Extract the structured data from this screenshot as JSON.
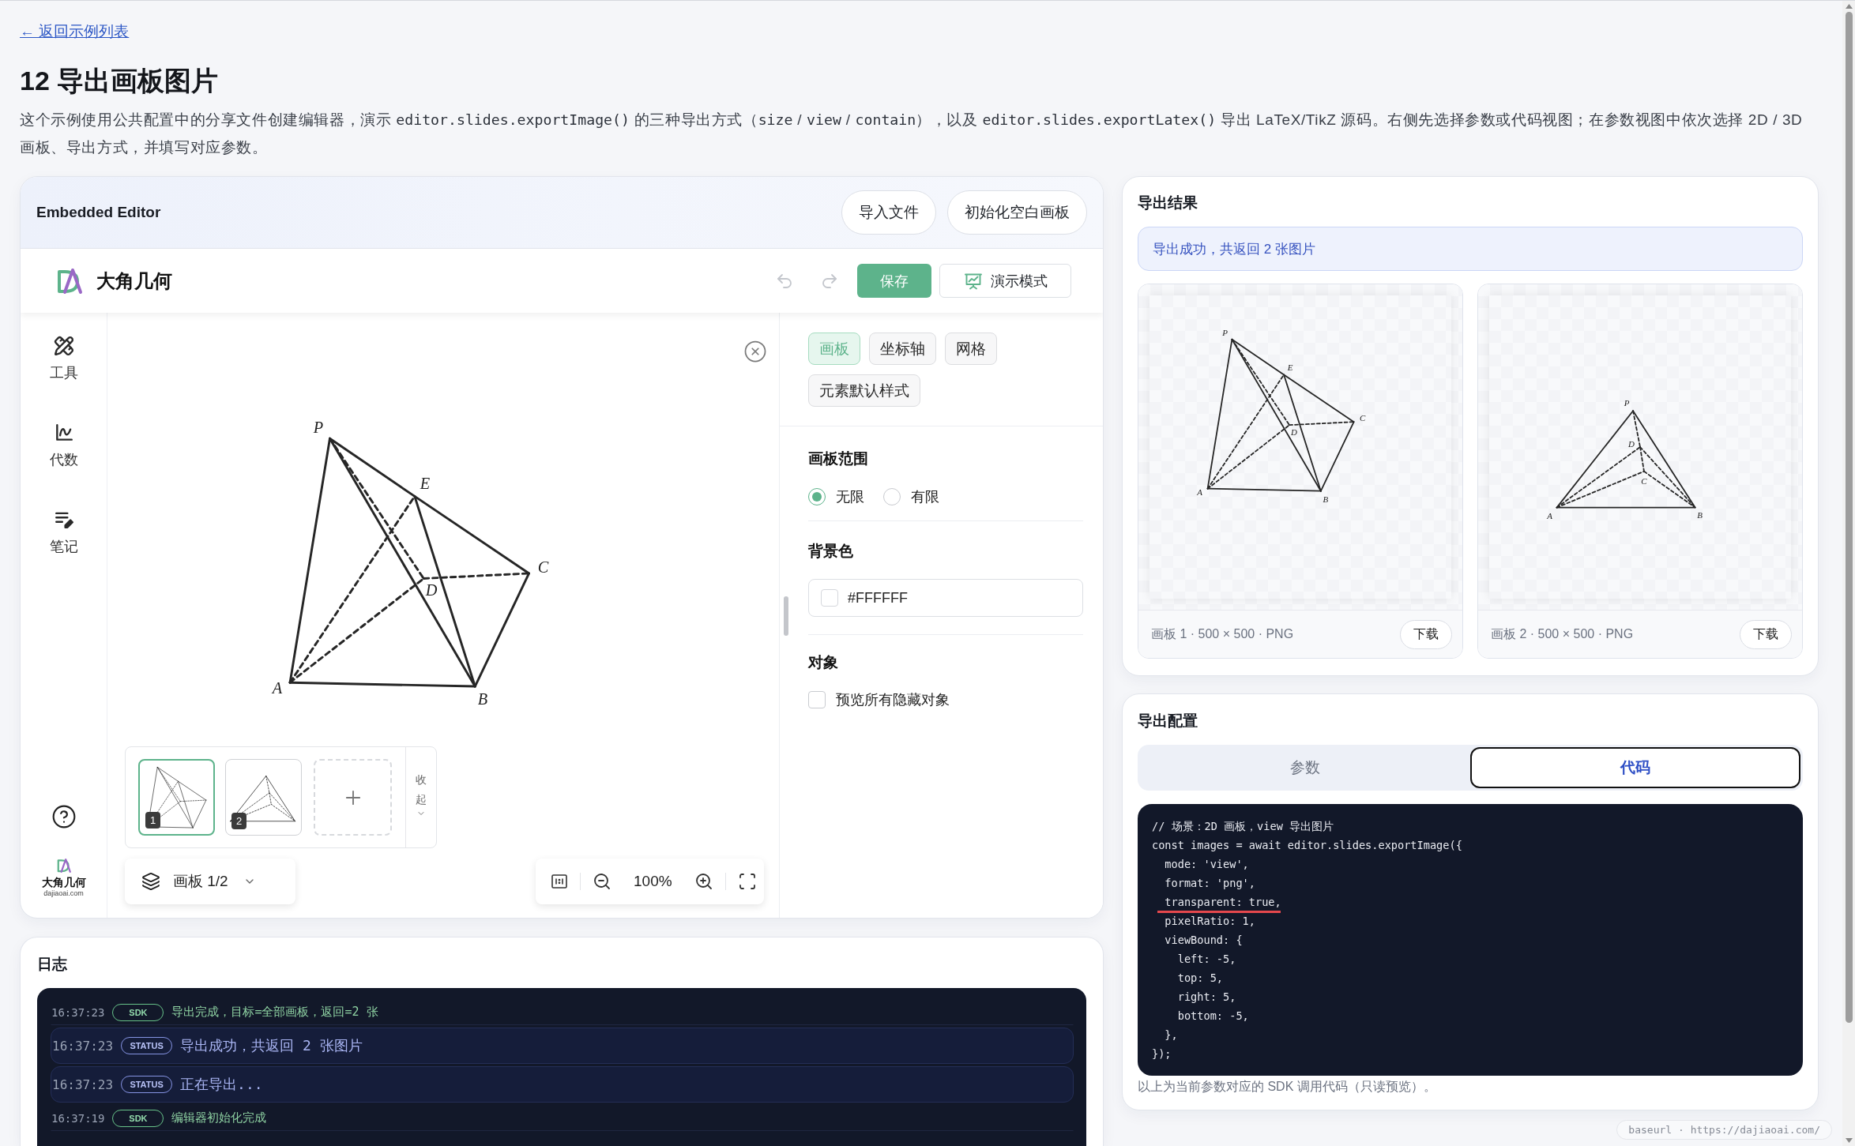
{
  "page": {
    "back_link": "← 返回示例列表",
    "title": "12 导出画板图片",
    "description": [
      {
        "kind": "text",
        "text": "这个示例使用公共配置中的分享文件创建编辑器，演示 "
      },
      {
        "kind": "code",
        "text": "editor.slides.exportImage()"
      },
      {
        "kind": "text",
        "text": " 的三种导出方式（"
      },
      {
        "kind": "code",
        "text": "size"
      },
      {
        "kind": "text",
        "text": " / "
      },
      {
        "kind": "code",
        "text": "view"
      },
      {
        "kind": "text",
        "text": " / "
      },
      {
        "kind": "code",
        "text": "contain"
      },
      {
        "kind": "text",
        "text": "），以及 "
      },
      {
        "kind": "code",
        "text": "editor.slides.exportLatex()"
      },
      {
        "kind": "text",
        "text": " 导出 LaTeX/TikZ 源码。右侧先选择参数或代码视图；在参数视图中依次选择 2D / 3D 画板、导出方式，并填写对应参数。"
      }
    ]
  },
  "editor": {
    "title": "Embedded Editor",
    "actions": [
      "导入文件",
      "初始化空白画板"
    ],
    "toolbar": {
      "brand": "大角几何",
      "history": [
        {
          "kind": "undo",
          "disabled": true
        },
        {
          "kind": "redo",
          "disabled": true
        }
      ],
      "save": "保存",
      "present": "演示模式"
    },
    "sidebar": {
      "items": [
        {
          "kind": "tools",
          "label": "工具"
        },
        {
          "kind": "algebra",
          "label": "代数"
        },
        {
          "kind": "notes",
          "label": "笔记"
        }
      ],
      "brand": "大角几何",
      "domain": "dajiaoai.com"
    },
    "canvas": {
      "figure": {
        "kind": "pyramid",
        "labels": [
          "P",
          "E",
          "C",
          "D",
          "A",
          "B"
        ]
      }
    },
    "slides": {
      "thumbnails": [
        {
          "number": "1",
          "kind": "pyramid",
          "selected": true
        },
        {
          "number": "2",
          "kind": "tetrahedron",
          "selected": false
        }
      ],
      "collapse": "收起",
      "current": "画板 1/2",
      "zoom": "100%"
    },
    "panel": {
      "tabs": [
        {
          "label": "画板",
          "selected": true
        },
        {
          "label": "坐标轴",
          "selected": false
        },
        {
          "label": "网格",
          "selected": false
        },
        {
          "label": "元素默认样式",
          "selected": false
        }
      ],
      "range": {
        "heading": "画板范围",
        "options": [
          {
            "label": "无限",
            "selected": true
          },
          {
            "label": "有限",
            "selected": false
          }
        ]
      },
      "background": {
        "heading": "背景色",
        "value": "#FFFFFF"
      },
      "objects": {
        "heading": "对象",
        "option": {
          "label": "预览所有隐藏对象",
          "checked": false
        }
      }
    }
  },
  "export_result": {
    "title": "导出结果",
    "alert": "导出成功，共返回 2 张图片",
    "images": [
      {
        "kind": "pyramid",
        "labels": [
          "P",
          "E",
          "C",
          "D",
          "A",
          "B"
        ],
        "meta": "画板 1 · 500 × 500 · PNG",
        "download": "下载"
      },
      {
        "kind": "tetrahedron",
        "labels": [
          "P",
          "D",
          "C",
          "A",
          "B"
        ],
        "meta": "画板 2 · 500 × 500 · PNG",
        "download": "下载"
      }
    ]
  },
  "export_config": {
    "title": "导出配置",
    "tabs": [
      {
        "label": "参数",
        "selected": false
      },
      {
        "label": "代码",
        "selected": true
      }
    ],
    "code": [
      {
        "text": "// 场景：2D 画板，view 导出图片",
        "highlighted": false
      },
      {
        "text": "const images = await editor.slides.exportImage({",
        "highlighted": false
      },
      {
        "text": "  mode: 'view',",
        "highlighted": false
      },
      {
        "text": "  format: 'png',",
        "highlighted": false
      },
      {
        "text": "  transparent: true,",
        "highlighted": true
      },
      {
        "text": "  pixelRatio: 1,",
        "highlighted": false
      },
      {
        "text": "  viewBound: {",
        "highlighted": false
      },
      {
        "text": "    left: -5,",
        "highlighted": false
      },
      {
        "text": "    top: 5,",
        "highlighted": false
      },
      {
        "text": "    right: 5,",
        "highlighted": false
      },
      {
        "text": "    bottom: -5,",
        "highlighted": false
      },
      {
        "text": "  },",
        "highlighted": false
      },
      {
        "text": "});",
        "highlighted": false
      }
    ],
    "note": "以上为当前参数对应的 SDK 调用代码（只读预览）。"
  },
  "log": {
    "title": "日志",
    "entries": [
      {
        "time": "16:37:23",
        "kind": "sdk",
        "tag": "SDK",
        "message": "导出完成，目标=全部画板，返回=2 张"
      },
      {
        "time": "16:37:23",
        "kind": "status",
        "tag": "STATUS",
        "message": "导出成功，共返回 2 张图片"
      },
      {
        "time": "16:37:23",
        "kind": "status",
        "tag": "STATUS",
        "message": "正在导出..."
      },
      {
        "time": "16:37:19",
        "kind": "sdk",
        "tag": "SDK",
        "message": "编辑器初始化完成"
      }
    ]
  },
  "base_url": "baseurl · https://dajiaoai.com/"
}
